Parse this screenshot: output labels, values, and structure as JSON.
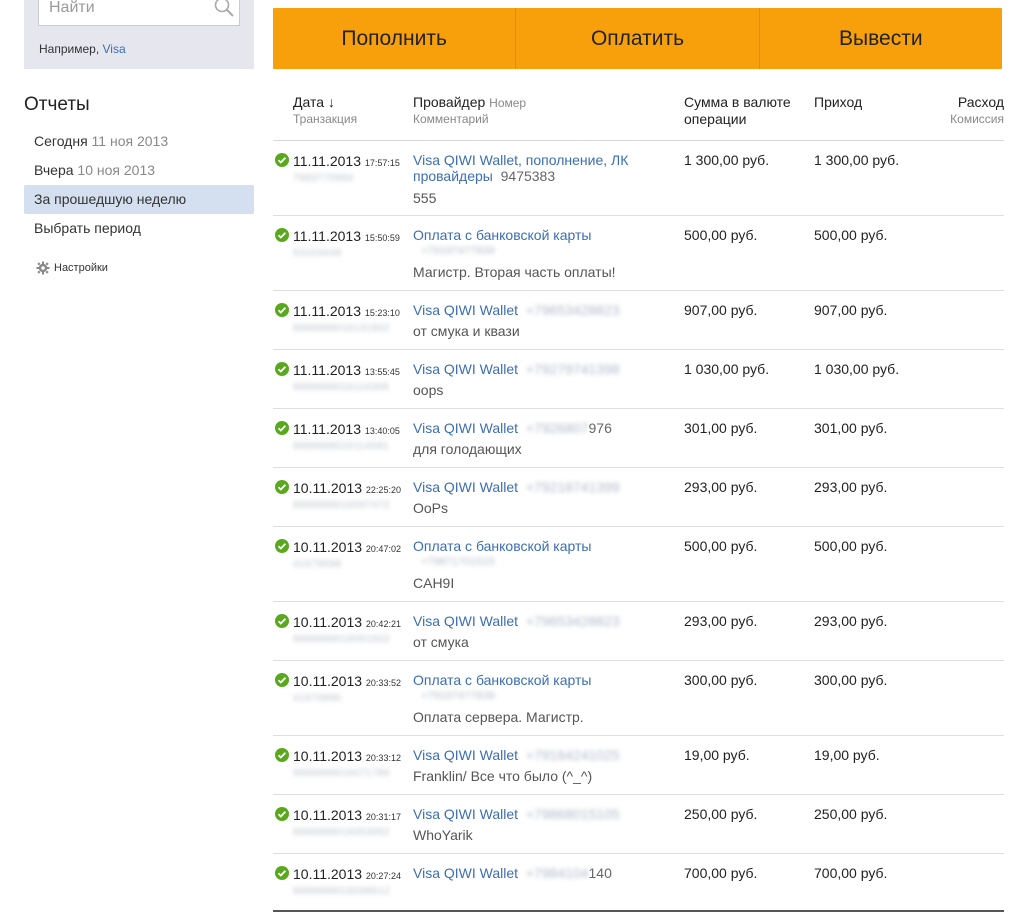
{
  "search": {
    "placeholder": "Найти",
    "example_prefix": "Например,",
    "example_link": "Visa"
  },
  "sidebar": {
    "title": "Отчеты",
    "items": [
      {
        "label": "Сегодня",
        "date": "11 ноя 2013"
      },
      {
        "label": "Вчера",
        "date": "10 ноя 2013"
      },
      {
        "label": "За прошедшую неделю",
        "date": ""
      },
      {
        "label": "Выбрать период",
        "date": ""
      }
    ],
    "settings": "Настройки"
  },
  "actions": {
    "topup": "Пополнить",
    "pay": "Оплатить",
    "withdraw": "Вывести"
  },
  "colors": {
    "accent": "#f7a00c",
    "link": "#3b6eb4",
    "success": "#5aa81e",
    "active_bg": "#d4e0ef"
  },
  "table": {
    "headers": {
      "date": "Дата ↓",
      "date_sub": "Транзакция",
      "provider": "Провайдер",
      "provider_number": "Номер",
      "provider_sub": "Комментарий",
      "sum": "Сумма в валюте операции",
      "income": "Приход",
      "expense": "Расход",
      "expense_sub": "Комиссия"
    },
    "rows": [
      {
        "date": "11.11.2013",
        "time": "17:57:15",
        "txn": "7983770984",
        "provider": "Visa QIWI Wallet, пополнение, ЛК провайдеры",
        "number": "9475383",
        "comment": "555",
        "sum": "1 300,00 руб.",
        "income": "1 300,00 руб."
      },
      {
        "date": "11.11.2013",
        "time": "15:50:59",
        "txn": "53103448",
        "provider": "Оплата с банковской карты",
        "card": "+79197477839",
        "comment": "Магистр. Вторая часть оплаты!",
        "sum": "500,00 руб.",
        "income": "500,00 руб."
      },
      {
        "date": "11.11.2013",
        "time": "15:23:10",
        "txn": "9999999016131902",
        "provider": "Visa QIWI Wallet",
        "number": "+79653428823",
        "comment": "от смука и квази",
        "sum": "907,00 руб.",
        "income": "907,00 руб."
      },
      {
        "date": "11.11.2013",
        "time": "13:55:45",
        "txn": "9999999016116305",
        "provider": "Visa QIWI Wallet",
        "number": "+79279741398",
        "comment": "oops",
        "sum": "1 030,00 руб.",
        "income": "1 030,00 руб."
      },
      {
        "date": "11.11.2013",
        "time": "13:40:05",
        "txn": "9999999016114581",
        "provider": "Visa QIWI Wallet",
        "number": "+7926807",
        "number_tail": "976",
        "comment": "для голодающих",
        "sum": "301,00 руб.",
        "income": "301,00 руб."
      },
      {
        "date": "10.11.2013",
        "time": "22:25:20",
        "txn": "9999999016097472",
        "provider": "Visa QIWI Wallet",
        "number": "+79218741399",
        "comment": "OoPs",
        "sum": "293,00 руб.",
        "income": "293,00 руб."
      },
      {
        "date": "10.11.2013",
        "time": "20:47:02",
        "txn": "41579598",
        "provider": "Оплата с банковской карты",
        "card": "+79871701515",
        "comment": "CAH9I",
        "sum": "500,00 руб.",
        "income": "500,00 руб."
      },
      {
        "date": "10.11.2013",
        "time": "20:42:21",
        "txn": "9999999016091602",
        "provider": "Visa QIWI Wallet",
        "number": "+79653428823",
        "comment": "от смука",
        "sum": "293,00 руб.",
        "income": "293,00 руб."
      },
      {
        "date": "10.11.2013",
        "time": "20:33:52",
        "txn": "41570890",
        "provider": "Оплата с банковской карты",
        "card": "+79197477839",
        "comment": "Оплата сервера. Магистр.",
        "sum": "300,00 руб.",
        "income": "300,00 руб."
      },
      {
        "date": "10.11.2013",
        "time": "20:33:12",
        "txn": "9999999016071780",
        "provider": "Visa QIWI Wallet",
        "number": "+79164241025",
        "comment": "Franklin/ Все что было (^_^)",
        "sum": "19,00 руб.",
        "income": "19,00 руб."
      },
      {
        "date": "10.11.2013",
        "time": "20:31:17",
        "txn": "9999999016053952",
        "provider": "Visa QIWI Wallet",
        "number": "+79868015105",
        "comment": "WhoYarik",
        "sum": "250,00 руб.",
        "income": "250,00 руб."
      },
      {
        "date": "10.11.2013",
        "time": "20:27:24",
        "txn": "9999999016038512",
        "provider": "Visa QIWI Wallet",
        "number": "+7984104",
        "number_tail": "140",
        "comment": "",
        "sum": "700,00 руб.",
        "income": "700,00 руб."
      }
    ]
  }
}
